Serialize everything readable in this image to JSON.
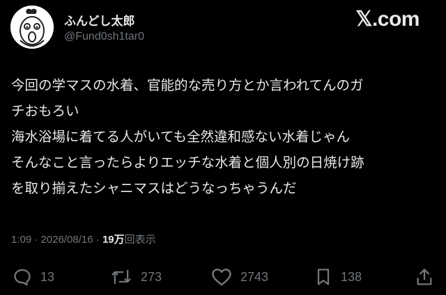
{
  "user": {
    "display_name": "ふんどし太郎",
    "handle": "@Fund0sh1tar0",
    "avatar_icon": "cartoon-character-avatar"
  },
  "brand": "𝕏.com",
  "tweet": {
    "lines": [
      "今回の学マスの水着、官能的な売り方とか言われてんのガ",
      "チおもろい",
      "海水浴場に着てる人がいても全然違和感ない水着じゃん",
      "そんなこと言ったらよりエッチな水着と個人別の日焼け跡",
      "を取り揃えたシャニマスはどうなっちゃうんだ"
    ],
    "time": "1:09",
    "separator": " · ",
    "date": "2026/08/16",
    "views_count": "19万",
    "views_label": "回表示"
  },
  "actions": {
    "replies": "13",
    "retweets": "273",
    "likes": "2743",
    "bookmarks": "138"
  },
  "colors": {
    "background": "#000000",
    "text": "#e7e9ea",
    "muted": "#71767b"
  }
}
